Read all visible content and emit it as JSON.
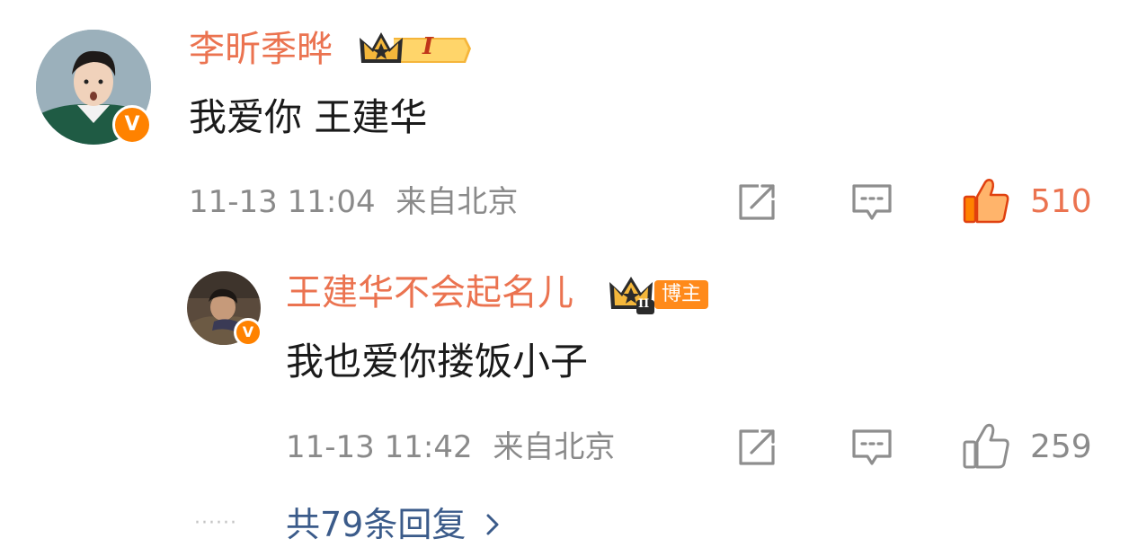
{
  "comment": {
    "username": "李昕季晔",
    "vip_level": "I",
    "text": "我爱你 王建华",
    "time": "11-13 11:04",
    "location": "来自北京",
    "likes": "510",
    "liked": true
  },
  "reply": {
    "username": "王建华不会起名儿",
    "vip_level": "II",
    "author_badge": "博主",
    "text": "我也爱你搂饭小子",
    "time": "11-13 11:42",
    "location": "来自北京",
    "likes": "259",
    "liked": false
  },
  "more_replies": {
    "dots": "······",
    "label": "共79条回复"
  },
  "verified_badge": "V",
  "colors": {
    "username": "#eb7350",
    "accent": "#ff8200",
    "meta": "#8a8a8a",
    "link": "#3b5b8a",
    "icon": "#8e8e8e"
  },
  "icons": [
    "share-icon",
    "comment-icon",
    "like-icon",
    "chevron-right-icon",
    "crown-icon"
  ]
}
